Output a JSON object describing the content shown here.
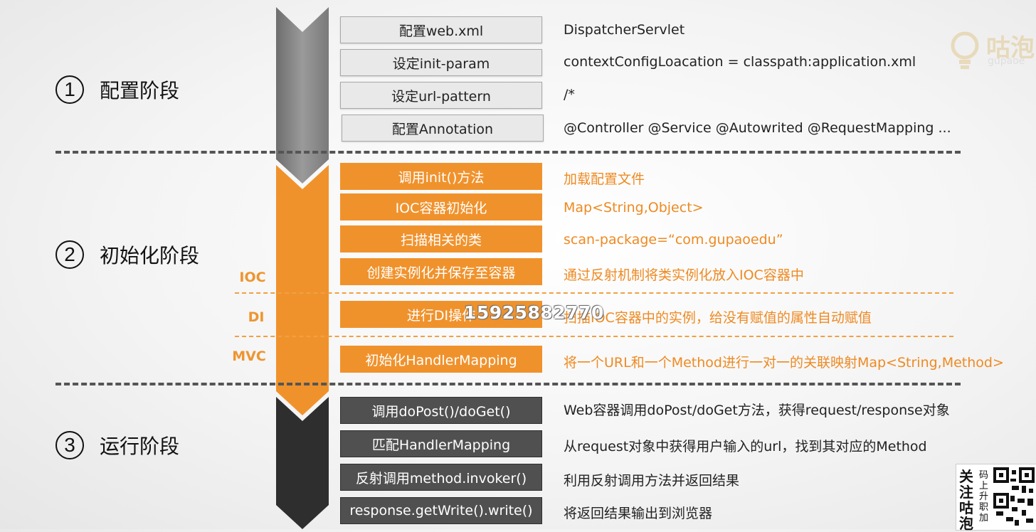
{
  "phases": [
    {
      "num": "1",
      "label": "配置阶段"
    },
    {
      "num": "2",
      "label": "初始化阶段"
    },
    {
      "num": "3",
      "label": "运行阶段"
    }
  ],
  "sublabels": {
    "ioc": "IOC",
    "di": "DI",
    "mvc": "MVC"
  },
  "config_steps": [
    {
      "step": "配置web.xml",
      "desc": "DispatcherServlet"
    },
    {
      "step": "设定init-param",
      "desc": "contextConfigLoacation = classpath:application.xml"
    },
    {
      "step": "设定url-pattern",
      "desc": "/*"
    },
    {
      "step": "配置Annotation",
      "desc": "@Controller  @Service  @Autowrited @RequestMapping ..."
    }
  ],
  "init_steps": [
    {
      "step": "调用init()方法",
      "desc": "加载配置文件"
    },
    {
      "step": "IOC容器初始化",
      "desc": "Map<String,Object>"
    },
    {
      "step": "扫描相关的类",
      "desc": "scan-package=“com.gupaoedu”"
    },
    {
      "step": "创建实例化并保存至容器",
      "desc": "通过反射机制将类实例化放入IOC容器中"
    },
    {
      "step": "进行DI操作",
      "desc": "扫描IOC容器中的实例，给没有赋值的属性自动赋值"
    },
    {
      "step": "初始化HandlerMapping",
      "desc": "将一个URL和一个Method进行一对一的关联映射Map<String,Method>"
    }
  ],
  "run_steps": [
    {
      "step": "调用doPost()/doGet()",
      "desc": "Web容器调用doPost/doGet方法，获得request/response对象"
    },
    {
      "step": "匹配HandlerMapping",
      "desc": "从request对象中获得用户输入的url，找到其对应的Method"
    },
    {
      "step": "反射调用method.invoker()",
      "desc": "利用反射调用方法并返回结果"
    },
    {
      "step": "response.getWrite().write()",
      "desc": "将返回结果输出到浏览器"
    }
  ],
  "logo": {
    "brand_cn": "咕泡",
    "brand_en": "gupaoe"
  },
  "watermark": "15925882770",
  "qr_block": {
    "vertical_text": "关注咕泡",
    "small_text": "码上升职加"
  },
  "colors": {
    "orange": "#f0922c",
    "gray_arrow": "#8c8c8c",
    "dark_arrow": "#2e2e2e",
    "dark_box": "#505050"
  }
}
